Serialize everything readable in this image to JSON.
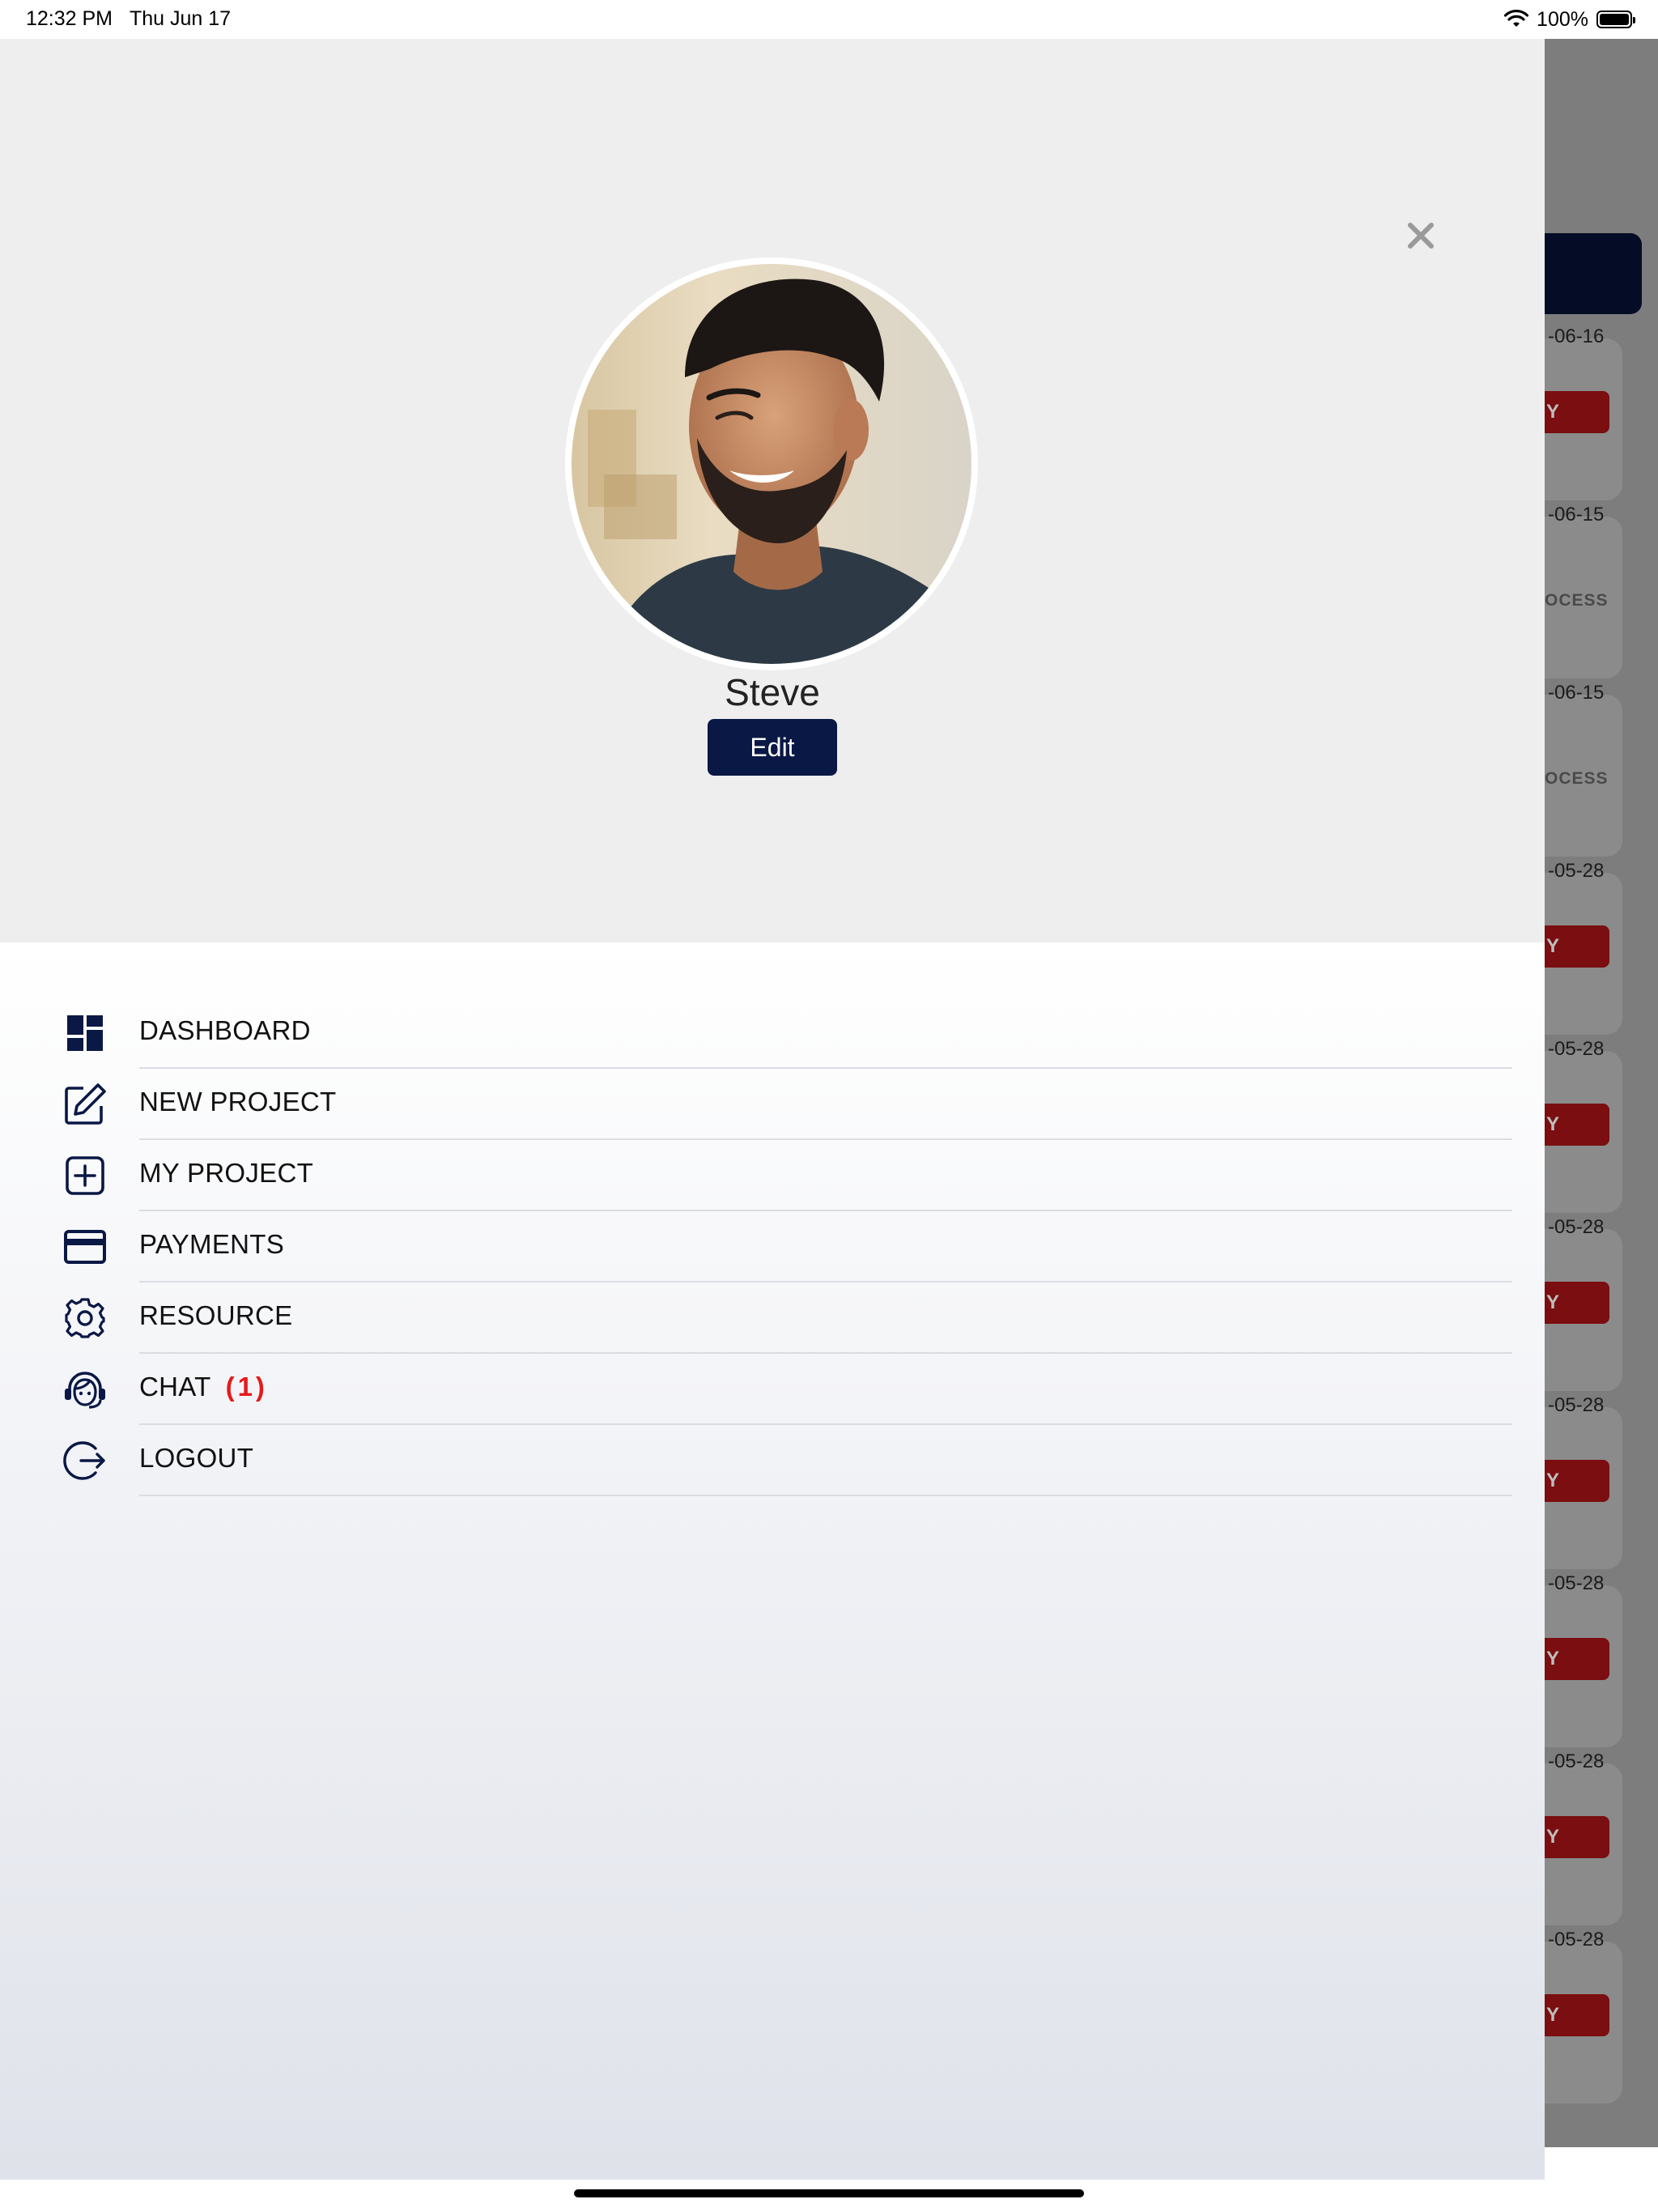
{
  "status_bar": {
    "time": "12:32 PM",
    "date": "Thu Jun 17",
    "battery": "100%"
  },
  "profile": {
    "name": "Steve",
    "edit_label": "Edit"
  },
  "menu": {
    "items": [
      {
        "label": "DASHBOARD",
        "icon": "dashboard-icon"
      },
      {
        "label": "NEW PROJECT",
        "icon": "edit-icon"
      },
      {
        "label": "MY PROJECT",
        "icon": "add-box-icon"
      },
      {
        "label": "PAYMENTS",
        "icon": "credit-card-icon"
      },
      {
        "label": "RESOURCE",
        "icon": "gear-icon"
      },
      {
        "label": "CHAT",
        "icon": "support-agent-icon",
        "badge": "(1)"
      },
      {
        "label": "LOGOUT",
        "icon": "logout-icon"
      }
    ]
  },
  "background_list": {
    "items": [
      {
        "date": "-06-16",
        "status": "Y"
      },
      {
        "date": "-06-15",
        "status": "OCESS"
      },
      {
        "date": "-06-15",
        "status": "OCESS"
      },
      {
        "date": "-05-28",
        "status": "Y"
      },
      {
        "date": "-05-28",
        "status": "Y"
      },
      {
        "date": "-05-28",
        "status": "Y"
      },
      {
        "date": "-05-28",
        "status": "Y"
      },
      {
        "date": "-05-28",
        "status": "Y"
      },
      {
        "date": "-05-28",
        "status": "Y"
      },
      {
        "date": "-05-28",
        "status": "Y"
      }
    ]
  },
  "colors": {
    "primary": "#0a1845",
    "badge": "#e41b1b",
    "pay_button": "#7a0e10"
  }
}
